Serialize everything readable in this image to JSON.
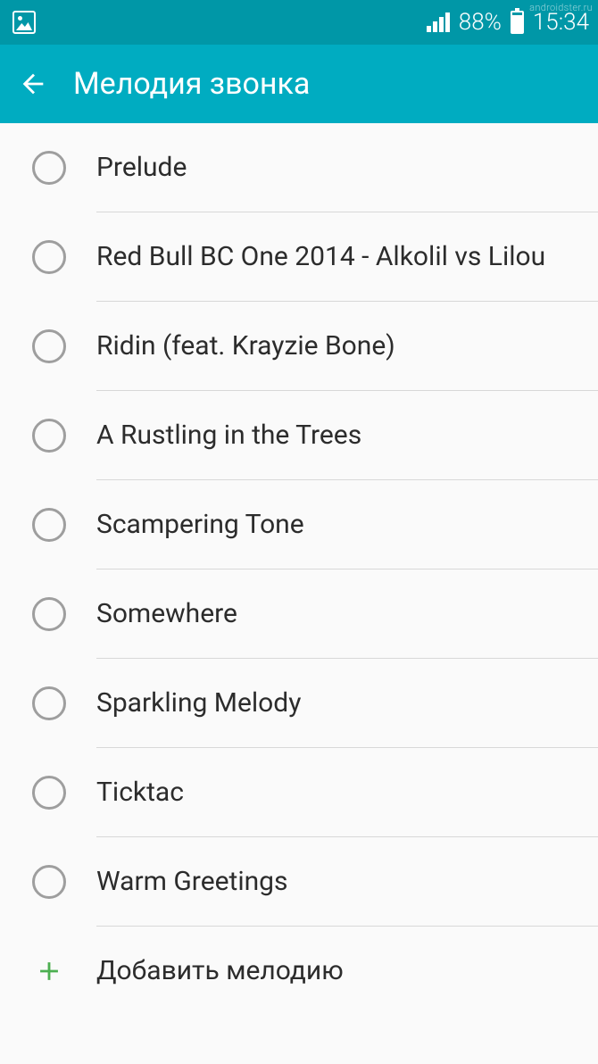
{
  "status": {
    "battery_percent": "88%",
    "time": "15:34",
    "watermark": "androidster.ru"
  },
  "header": {
    "title": "Мелодия звонка"
  },
  "ringtones": [
    {
      "label": "Prelude"
    },
    {
      "label": "Red Bull BC One 2014 - Alkolil vs Lilou"
    },
    {
      "label": "Ridin (feat. Krayzie Bone)"
    },
    {
      "label": "A Rustling in the Trees"
    },
    {
      "label": "Scampering Tone"
    },
    {
      "label": "Somewhere"
    },
    {
      "label": "Sparkling Melody"
    },
    {
      "label": "Ticktac"
    },
    {
      "label": "Warm Greetings"
    }
  ],
  "add_action": {
    "label": "Добавить мелодию"
  },
  "colors": {
    "primary": "#00acc1",
    "primary_dark": "#0097a7",
    "accent_green": "#4caf50"
  }
}
